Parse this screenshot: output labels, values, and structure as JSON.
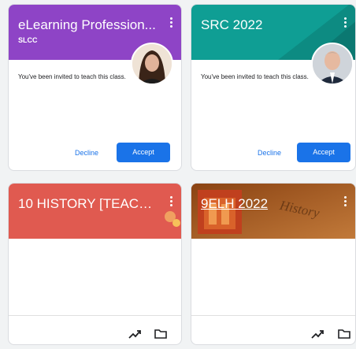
{
  "colors": {
    "accent": "#1a73e8",
    "card1_banner": "#8e44c6",
    "card2_banner": "#0f9e94",
    "card3_banner": "#e05a50",
    "card4_banner": "#a0541c"
  },
  "cards": [
    {
      "title": "eLearning Profession...",
      "subtitle": "SLCC",
      "invite_text": "You've been invited to teach this class.",
      "decline_label": "Decline",
      "accept_label": "Accept"
    },
    {
      "title": "SRC 2022",
      "invite_text": "You've been invited to teach this class.",
      "decline_label": "Decline",
      "accept_label": "Accept"
    },
    {
      "title": "10 HISTORY [TEACHE...",
      "footer_icons": [
        "trending-up-icon",
        "folder-icon"
      ]
    },
    {
      "title": "9ELH 2022",
      "banner_art_text": "History",
      "footer_icons": [
        "trending-up-icon",
        "folder-icon"
      ]
    }
  ]
}
